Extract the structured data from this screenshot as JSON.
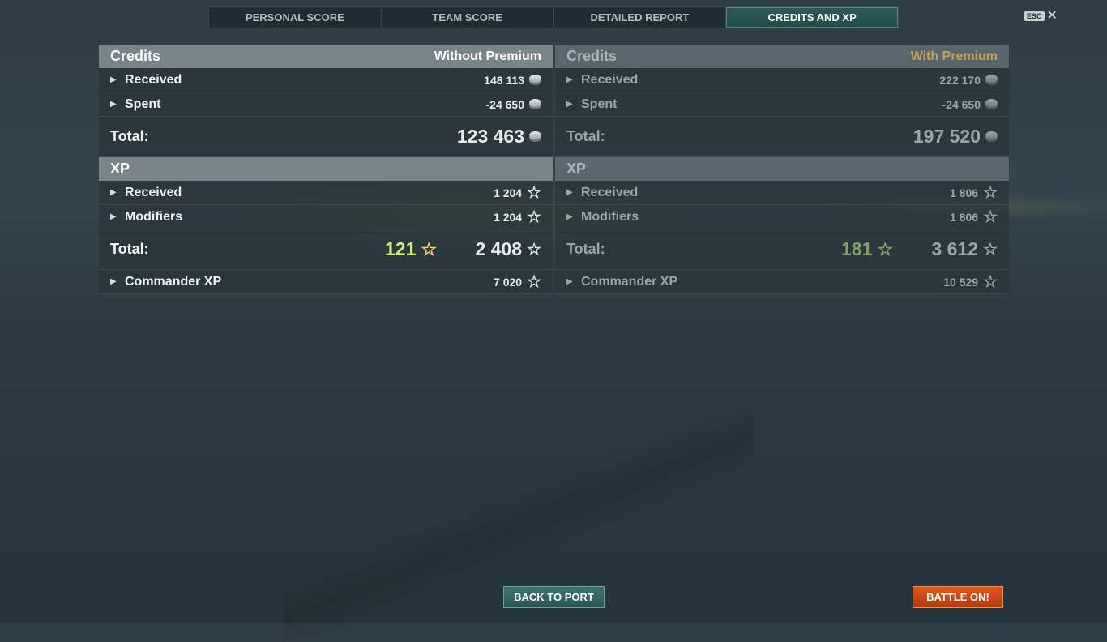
{
  "tabs": [
    {
      "label": "PERSONAL SCORE"
    },
    {
      "label": "TEAM SCORE"
    },
    {
      "label": "DETAILED REPORT"
    },
    {
      "label": "CREDITS AND XP",
      "active": true
    }
  ],
  "close": {
    "key_label": "ESC",
    "icon": "close-icon"
  },
  "without_premium": {
    "credits": {
      "title": "Credits",
      "subtitle": "Without Premium",
      "received": {
        "label": "Received",
        "value": "148 113"
      },
      "spent": {
        "label": "Spent",
        "value": "-24 650"
      },
      "total": {
        "label": "Total:",
        "value": "123 463"
      }
    },
    "xp": {
      "title": "XP",
      "received": {
        "label": "Received",
        "value": "1 204"
      },
      "modifiers": {
        "label": "Modifiers",
        "value": "1 204"
      },
      "total": {
        "label": "Total:",
        "bonus": "121",
        "value": "2 408"
      },
      "commander": {
        "label": "Commander XP",
        "value": "7 020"
      }
    }
  },
  "with_premium": {
    "credits": {
      "title": "Credits",
      "subtitle": "With Premium",
      "received": {
        "label": "Received",
        "value": "222 170"
      },
      "spent": {
        "label": "Spent",
        "value": "-24 650"
      },
      "total": {
        "label": "Total:",
        "value": "197 520"
      }
    },
    "xp": {
      "title": "XP",
      "received": {
        "label": "Received",
        "value": "1 806"
      },
      "modifiers": {
        "label": "Modifiers",
        "value": "1 806"
      },
      "total": {
        "label": "Total:",
        "bonus": "181",
        "value": "3 612"
      },
      "commander": {
        "label": "Commander XP",
        "value": "10 529"
      }
    }
  },
  "buttons": {
    "back": "BACK TO PORT",
    "battle": "BATTLE ON!"
  },
  "colors": {
    "active_tab": "#2f5a5a",
    "premium_label": "#c8a050",
    "bonus_xp": "#c8ee7a",
    "battle_button": "#d4501a",
    "back_button": "#3a6e6d"
  }
}
